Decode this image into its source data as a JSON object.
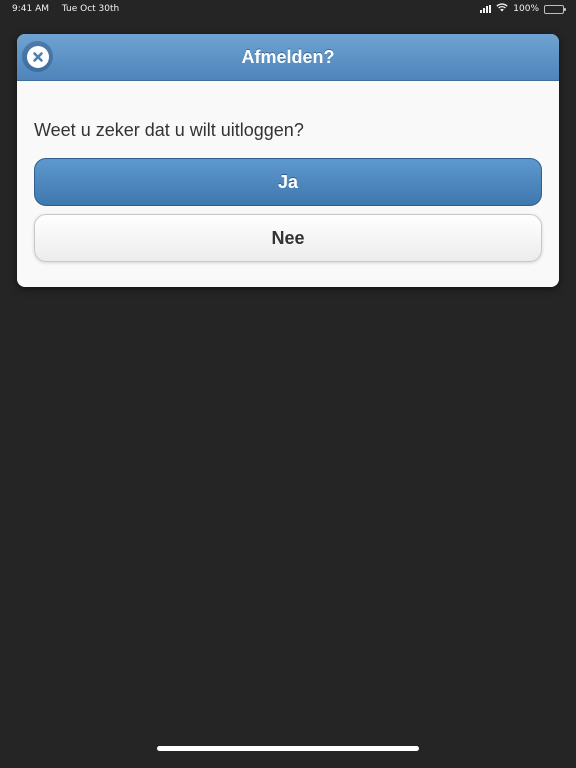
{
  "status_bar": {
    "time": "9:41 AM",
    "date": "Tue Oct 30th",
    "battery": "100%"
  },
  "dialog": {
    "title": "Afmelden?",
    "message": "Weet u zeker dat u wilt uitloggen?",
    "confirm_label": "Ja",
    "cancel_label": "Nee"
  },
  "colors": {
    "header": "#5a90c6",
    "confirm_button": "#4f87bf",
    "background": "#252525"
  },
  "icons": {
    "close": "close-icon",
    "signal": "cellular-signal-icon",
    "wifi": "wifi-icon",
    "battery": "battery-icon"
  }
}
